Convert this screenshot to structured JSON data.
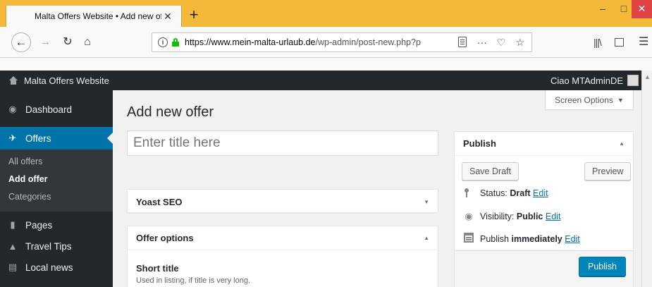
{
  "browser": {
    "tab_title": "Malta Offers Website • Add new off",
    "tab_close": "✕",
    "new_tab": "+",
    "url_host": "https://www.mein-malta-urlaub.de",
    "url_path": "/wp-admin/post-new.php?p",
    "window": {
      "minimize": "–",
      "maximize": "□",
      "close": "✕"
    }
  },
  "adminbar": {
    "site_name": "Malta Offers Website",
    "howdy": "Ciao MTAdminDE"
  },
  "menu": {
    "dashboard": "Dashboard",
    "offers": "Offers",
    "submenu": {
      "all": "All offers",
      "add": "Add offer",
      "categories": "Categories"
    },
    "pages": "Pages",
    "travel_tips": "Travel Tips",
    "local_news": "Local news"
  },
  "screen_options": {
    "label": "Screen Options",
    "arrow": "▼"
  },
  "page": {
    "title": "Add new offer",
    "title_placeholder": "Enter title here"
  },
  "yoast": {
    "title": "Yoast SEO",
    "arrow": "▼"
  },
  "offer_options": {
    "title": "Offer options",
    "arrow": "▲",
    "short_title_label": "Short title",
    "short_title_desc": "Used in listing, if title is very long."
  },
  "publish": {
    "title": "Publish",
    "arrow": "▲",
    "save_draft": "Save Draft",
    "preview": "Preview",
    "status_label": "Status: ",
    "status_value": "Draft",
    "visibility_label": "Visibility: ",
    "visibility_value": "Public",
    "schedule_label": "Publish ",
    "schedule_value": "immediately",
    "edit": "Edit",
    "publish_button": "Publish"
  },
  "colors": {
    "browser_tabbar": "#f5b93a",
    "admin_dark": "#23282d",
    "accent_blue": "#0073aa",
    "publish_blue": "#0085ba"
  }
}
